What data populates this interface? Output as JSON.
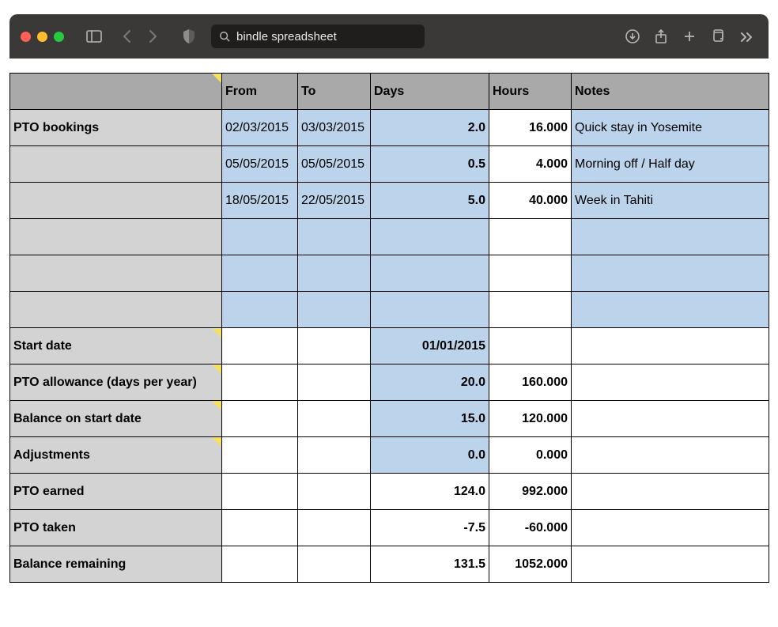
{
  "toolbar": {
    "address_text": "bindle spreadsheet"
  },
  "headers": {
    "label": "",
    "from": "From",
    "to": "To",
    "days": "Days",
    "hours": "Hours",
    "notes": "Notes"
  },
  "bookings_label": "PTO bookings",
  "bookings": [
    {
      "from": "02/03/2015",
      "to": "03/03/2015",
      "days": "2.0",
      "hours": "16.000",
      "notes": "Quick stay in Yosemite"
    },
    {
      "from": "05/05/2015",
      "to": "05/05/2015",
      "days": "0.5",
      "hours": "4.000",
      "notes": "Morning off / Half day"
    },
    {
      "from": "18/05/2015",
      "to": "22/05/2015",
      "days": "5.0",
      "hours": "40.000",
      "notes": "Week in Tahiti"
    }
  ],
  "summary": {
    "start_date": {
      "label": "Start date",
      "days": "01/01/2015",
      "hours": ""
    },
    "allowance": {
      "label": "PTO allowance (days per year)",
      "days": "20.0",
      "hours": "160.000"
    },
    "balance_start": {
      "label": "Balance on start date",
      "days": "15.0",
      "hours": "120.000"
    },
    "adjustments": {
      "label": "Adjustments",
      "days": "0.0",
      "hours": "0.000"
    },
    "earned": {
      "label": "PTO earned",
      "days": "124.0",
      "hours": "992.000"
    },
    "taken": {
      "label": "PTO taken",
      "days": "-7.5",
      "hours": "-60.000"
    },
    "balance_remaining": {
      "label": "Balance remaining",
      "days": "131.5",
      "hours": "1052.000"
    }
  }
}
